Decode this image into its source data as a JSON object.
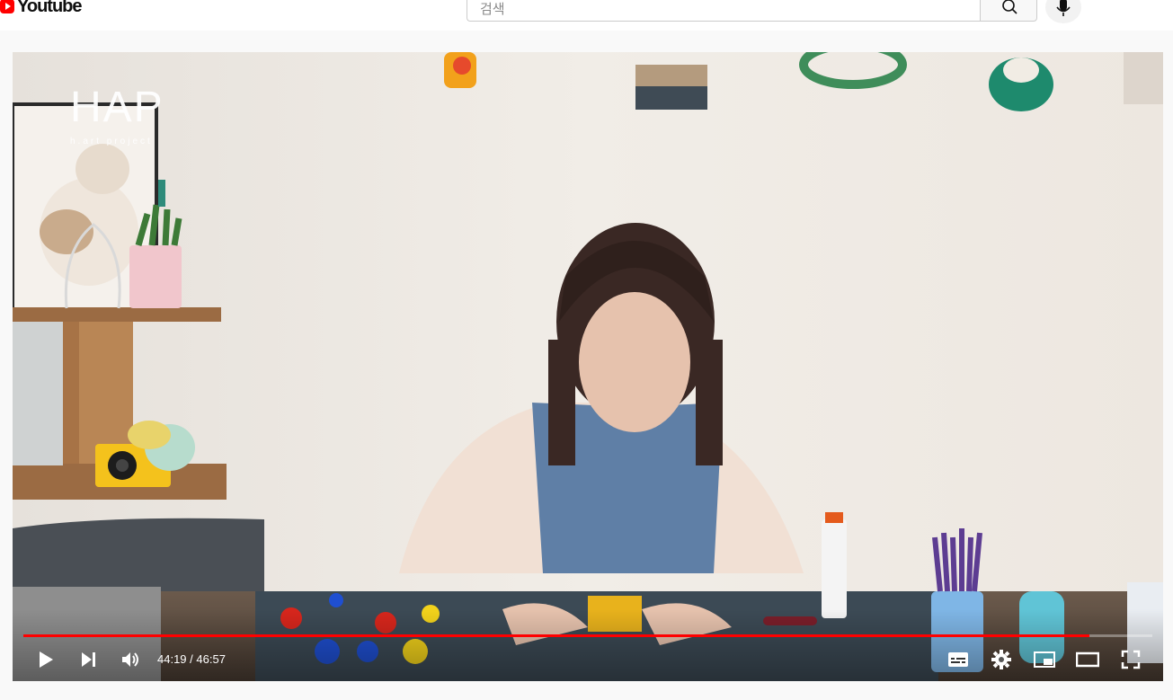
{
  "header": {
    "logo_text": "Youtube",
    "search_placeholder": "검색"
  },
  "video": {
    "overlay_logo": "HAP",
    "overlay_sub": "h.art project",
    "current_time": "44:19",
    "duration": "46:57",
    "progress": 0.944,
    "progress_color": "#ff0000"
  },
  "icons": {
    "search": "search-icon",
    "mic": "mic-icon",
    "play": "play-icon",
    "next": "next-icon",
    "volume": "volume-icon",
    "subtitles": "subtitles-icon",
    "settings": "gear-icon",
    "miniplayer": "miniplayer-icon",
    "theater": "theater-icon",
    "fullscreen": "fullscreen-icon"
  }
}
